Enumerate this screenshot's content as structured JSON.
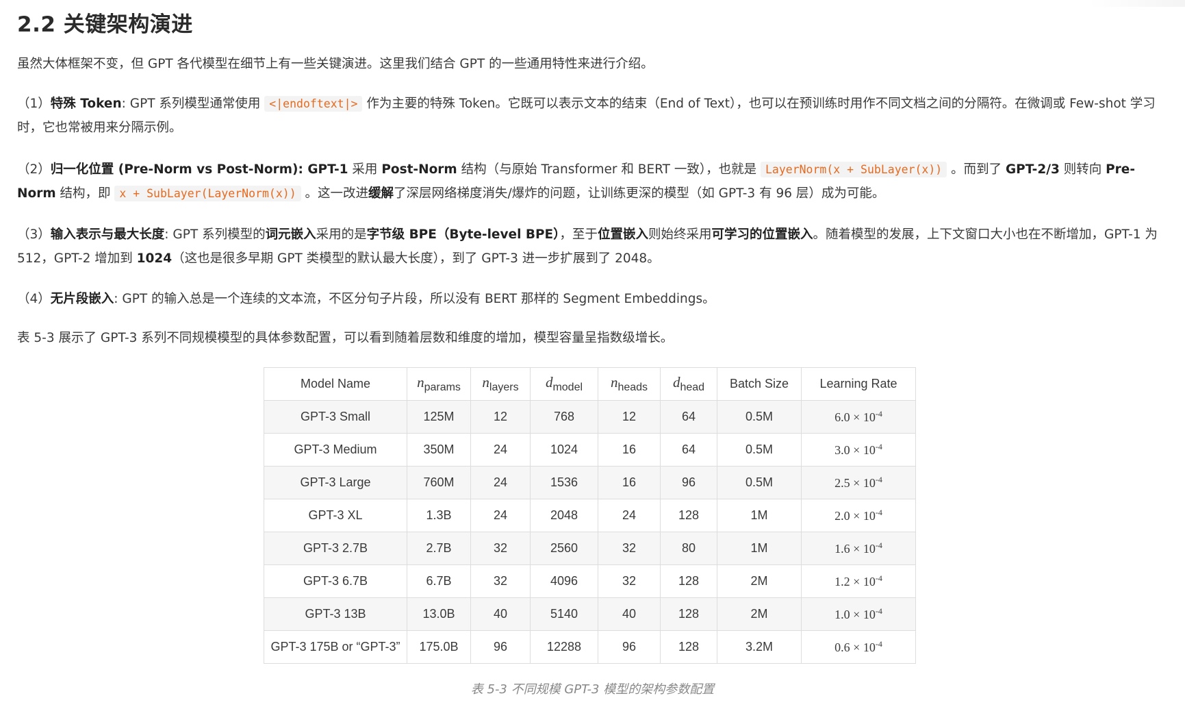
{
  "heading": "2.2 关键架构演进",
  "intro": "虽然大体框架不变，但 GPT 各代模型在细节上有一些关键演进。这里我们结合 GPT 的一些通用特性来进行介绍。",
  "p1": {
    "num": "（1）",
    "bold": "特殊 Token",
    "t1": ": GPT 系列模型通常使用 ",
    "code": "<|endoftext|>",
    "t2": " 作为主要的特殊 Token。它既可以表示文本的结束（End of Text），也可以在预训练时用作不同文档之间的分隔符。在微调或 Few-shot 学习时，它也常被用来分隔示例。"
  },
  "p2": {
    "num": "（2）",
    "bold1": "归一化位置",
    "t1": " (Pre-Norm vs Post-Norm): ",
    "bold2": "GPT-1",
    "t2": " 采用 ",
    "bold3": "Post-Norm",
    "t3": " 结构（与原始 Transformer 和 BERT 一致），也就是 ",
    "code1": "LayerNorm(x + SubLayer(x))",
    "t4": " 。而到了 ",
    "bold4": "GPT-2/3",
    "t5": " 则转向 ",
    "bold5": "Pre-Norm",
    "t6": " 结构，即 ",
    "code2": "x + SubLayer(LayerNorm(x))",
    "t7": " 。这一改进",
    "bold6": "缓解",
    "t8": "了深层网络梯度消失/爆炸的问题，让训练更深的模型（如 GPT-3 有 96 层）成为可能。"
  },
  "p3": {
    "num": "（3）",
    "bold1": "输入表示与最大长度",
    "t1": ": GPT 系列模型的",
    "bold2": "词元嵌入",
    "t2": "采用的是",
    "bold3": "字节级 BPE（Byte-level BPE）",
    "t3": "，至于",
    "bold4": "位置嵌入",
    "t4": "则始终采用",
    "bold5": "可学习的位置嵌入",
    "t5": "。随着模型的发展，上下文窗口大小也在不断增加，GPT-1 为 512，GPT-2 增加到 ",
    "bold6": "1024",
    "t6": "（这也是很多早期 GPT 类模型的默认最大长度），到了 GPT-3 进一步扩展到了 2048。"
  },
  "p4": {
    "num": "（4）",
    "bold": "无片段嵌入",
    "t1": ": GPT 的输入总是一个连续的文本流，不区分句子片段，所以没有 BERT 那样的 Segment Embeddings。"
  },
  "table_intro": "表 5-3 展示了 GPT-3 系列不同规模模型的具体参数配置，可以看到随着层数和维度的增加，模型容量呈指数级增长。",
  "table": {
    "headers": [
      {
        "text": "Model Name"
      },
      {
        "sym": "n",
        "sub": "params"
      },
      {
        "sym": "n",
        "sub": "layers"
      },
      {
        "sym": "d",
        "sub": "model"
      },
      {
        "sym": "n",
        "sub": "heads"
      },
      {
        "sym": "d",
        "sub": "head"
      },
      {
        "text": "Batch Size"
      },
      {
        "text": "Learning Rate"
      }
    ],
    "rows": [
      [
        "GPT-3 Small",
        "125M",
        "12",
        "768",
        "12",
        "64",
        "0.5M",
        "6.0 × 10",
        "-4"
      ],
      [
        "GPT-3 Medium",
        "350M",
        "24",
        "1024",
        "16",
        "64",
        "0.5M",
        "3.0 × 10",
        "-4"
      ],
      [
        "GPT-3 Large",
        "760M",
        "24",
        "1536",
        "16",
        "96",
        "0.5M",
        "2.5 × 10",
        "-4"
      ],
      [
        "GPT-3 XL",
        "1.3B",
        "24",
        "2048",
        "24",
        "128",
        "1M",
        "2.0 × 10",
        "-4"
      ],
      [
        "GPT-3 2.7B",
        "2.7B",
        "32",
        "2560",
        "32",
        "80",
        "1M",
        "1.6 × 10",
        "-4"
      ],
      [
        "GPT-3 6.7B",
        "6.7B",
        "32",
        "4096",
        "32",
        "128",
        "2M",
        "1.2 × 10",
        "-4"
      ],
      [
        "GPT-3 13B",
        "13.0B",
        "40",
        "5140",
        "40",
        "128",
        "2M",
        "1.0 × 10",
        "-4"
      ],
      [
        "GPT-3 175B or “GPT-3”",
        "175.0B",
        "96",
        "12288",
        "96",
        "128",
        "3.2M",
        "0.6 × 10",
        "-4"
      ]
    ]
  },
  "caption": "表 5-3 不同规模 GPT-3 模型的架构参数配置"
}
